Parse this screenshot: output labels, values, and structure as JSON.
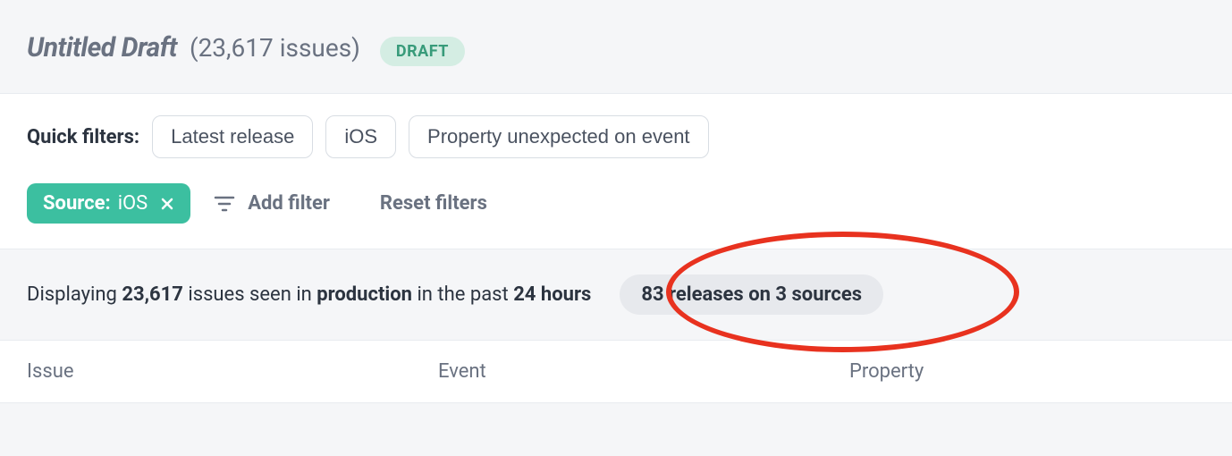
{
  "header": {
    "title": "Untitled Draft",
    "issue_count_text": "(23,617 issues)",
    "badge": "DRAFT"
  },
  "quick_filters": {
    "label": "Quick filters:",
    "items": [
      "Latest release",
      "iOS",
      "Property unexpected on event"
    ]
  },
  "active_filter": {
    "label": "Source:",
    "value": "iOS"
  },
  "add_filter": "Add filter",
  "reset_filters": "Reset filters",
  "summary": {
    "prefix": "Displaying ",
    "count": "23,617",
    "mid1": " issues seen in ",
    "env": "production",
    "mid2": " in the past ",
    "period": "24 hours",
    "releases_pill": "83 releases on 3 sources"
  },
  "table": {
    "columns": [
      "Issue",
      "Event",
      "Property"
    ]
  }
}
